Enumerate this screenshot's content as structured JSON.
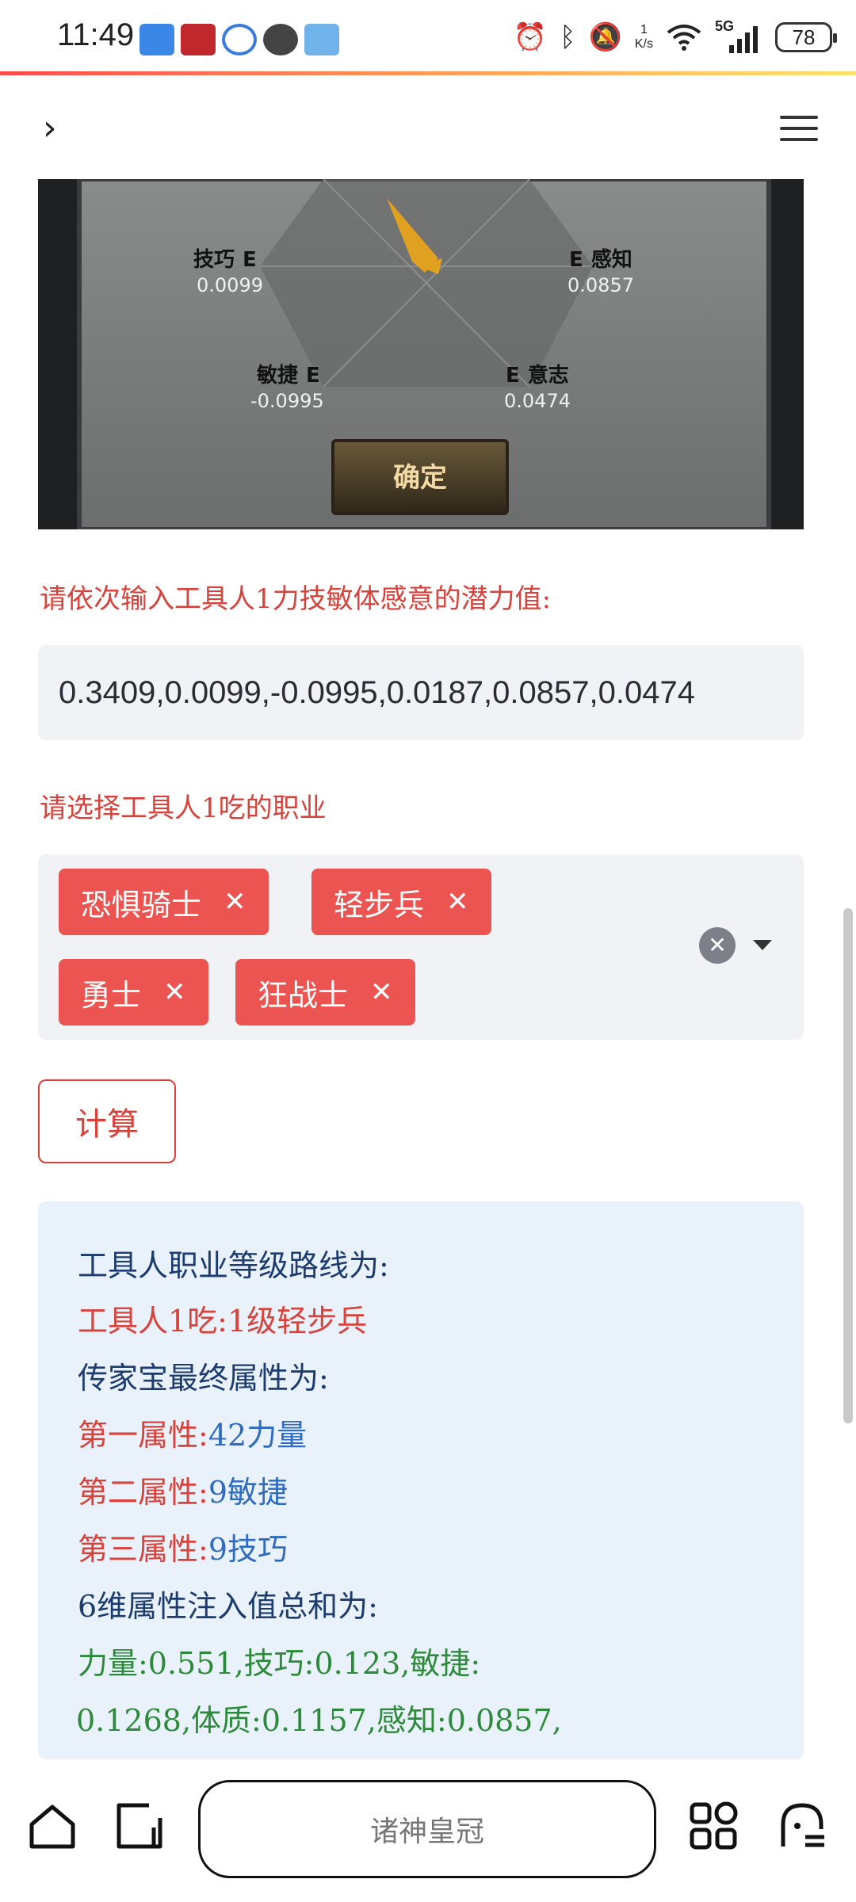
{
  "status_bar": {
    "time": "11:49",
    "speed_value": "1",
    "speed_unit": "K/s",
    "network": "5G",
    "battery": "78"
  },
  "header": {
    "back_icon": "chevron-right-icon",
    "menu_icon": "hamburger-menu-icon"
  },
  "game_panel": {
    "stats": [
      {
        "name": "技巧",
        "grade": "E",
        "value": "0.0099"
      },
      {
        "name": "感知",
        "grade": "E",
        "value": "0.0857"
      },
      {
        "name": "敏捷",
        "grade": "E",
        "value": "-0.0995"
      },
      {
        "name": "意志",
        "grade": "E",
        "value": "0.0474"
      }
    ],
    "confirm_label": "确定"
  },
  "form": {
    "potential_prompt": "请依次输入工具人1力技敏体感意的潜力值:",
    "potential_value": "0.3409,0.0099,-0.0995,0.0187,0.0857,0.0474",
    "class_prompt": "请选择工具人1吃的职业",
    "selected_classes": [
      "恐惧骑士",
      "轻步兵",
      "勇士",
      "狂战士"
    ],
    "calc_button": "计算"
  },
  "result": {
    "route_title": "工具人职业等级路线为:",
    "route_value": "工具人1吃:1级轻步兵",
    "heirloom_title": "传家宝最终属性为:",
    "attr1_label": "第一属性:",
    "attr1_value": "42力量",
    "attr2_label": "第二属性:",
    "attr2_value": "9敏捷",
    "attr3_label": "第三属性:",
    "attr3_value": "9技巧",
    "sum_title": "6维属性注入值总和为:",
    "sum_line1": "力量:0.551,技巧:0.123,敏捷:",
    "sum_line2": "0.1268,体质:0.1157,感知:0.0857,"
  },
  "bottom_nav": {
    "search_text": "诸神皇冠",
    "icons": [
      "home-icon",
      "tabs-icon",
      "apps-grid-icon",
      "assistant-icon"
    ]
  },
  "colors": {
    "accent_red": "#d9423a",
    "tag_red": "#eb5450",
    "result_bg": "#e9f1fa",
    "result_blue": "#2f6bbf",
    "result_green": "#2d8a3a"
  }
}
